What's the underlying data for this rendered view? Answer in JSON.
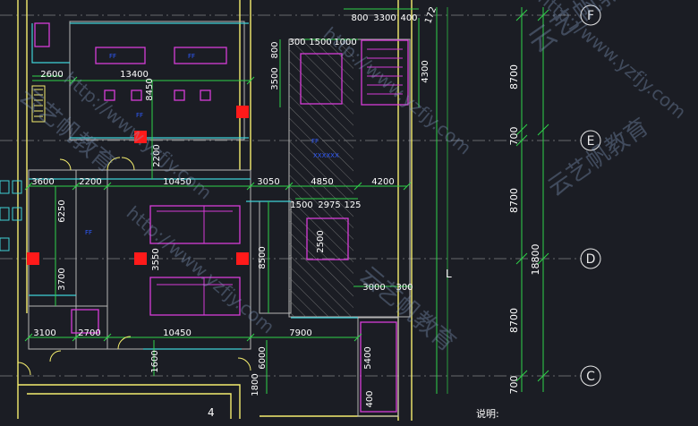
{
  "colors": {
    "background": "#1b1d24",
    "wall": "#f4ed6e",
    "wall_alt": "#e8e0a0",
    "green": "#2fd24a",
    "cyan": "#3fd1d6",
    "magenta": "#d63cd6",
    "blue": "#2f5bff",
    "red": "#ff1a1a",
    "white": "#e8e8e8",
    "grey": "#8c8c8c",
    "watermark": "#8aa4c8"
  },
  "axes": [
    {
      "label": "F"
    },
    {
      "label": "E"
    },
    {
      "label": "D"
    },
    {
      "label": "C"
    }
  ],
  "dims_right_inner": [
    "8700",
    "700",
    "8700",
    "8700",
    "700"
  ],
  "dim_right_total": "18800",
  "dims_top": [
    "800",
    "3300",
    "400",
    "300",
    "1500",
    "1000"
  ],
  "dims_row1": [
    "3600",
    "2200",
    "10450",
    "3050",
    "4850",
    "4200"
  ],
  "dims_row2": [
    "3100",
    "2700",
    "10450",
    "7900"
  ],
  "dims_vertical": [
    "13400",
    "8450",
    "2200",
    "6250",
    "3700",
    "3550",
    "8500",
    "2500",
    "3500",
    "800",
    "4300",
    "5400",
    "6000",
    "1600",
    "1800",
    "400"
  ],
  "dims_misc": [
    "2600",
    "1500",
    "2975",
    "125",
    "3000",
    "300",
    "172"
  ],
  "room_labels": [
    "FF",
    "FF",
    "FF",
    "FF",
    "FF"
  ],
  "shaft_label": "XXXXXX",
  "marker_l": "L",
  "marker_4": "4",
  "note_label": "说明:",
  "watermark_url": "http://www.yzfjy.com",
  "watermark_cn": "云艺帆教育"
}
